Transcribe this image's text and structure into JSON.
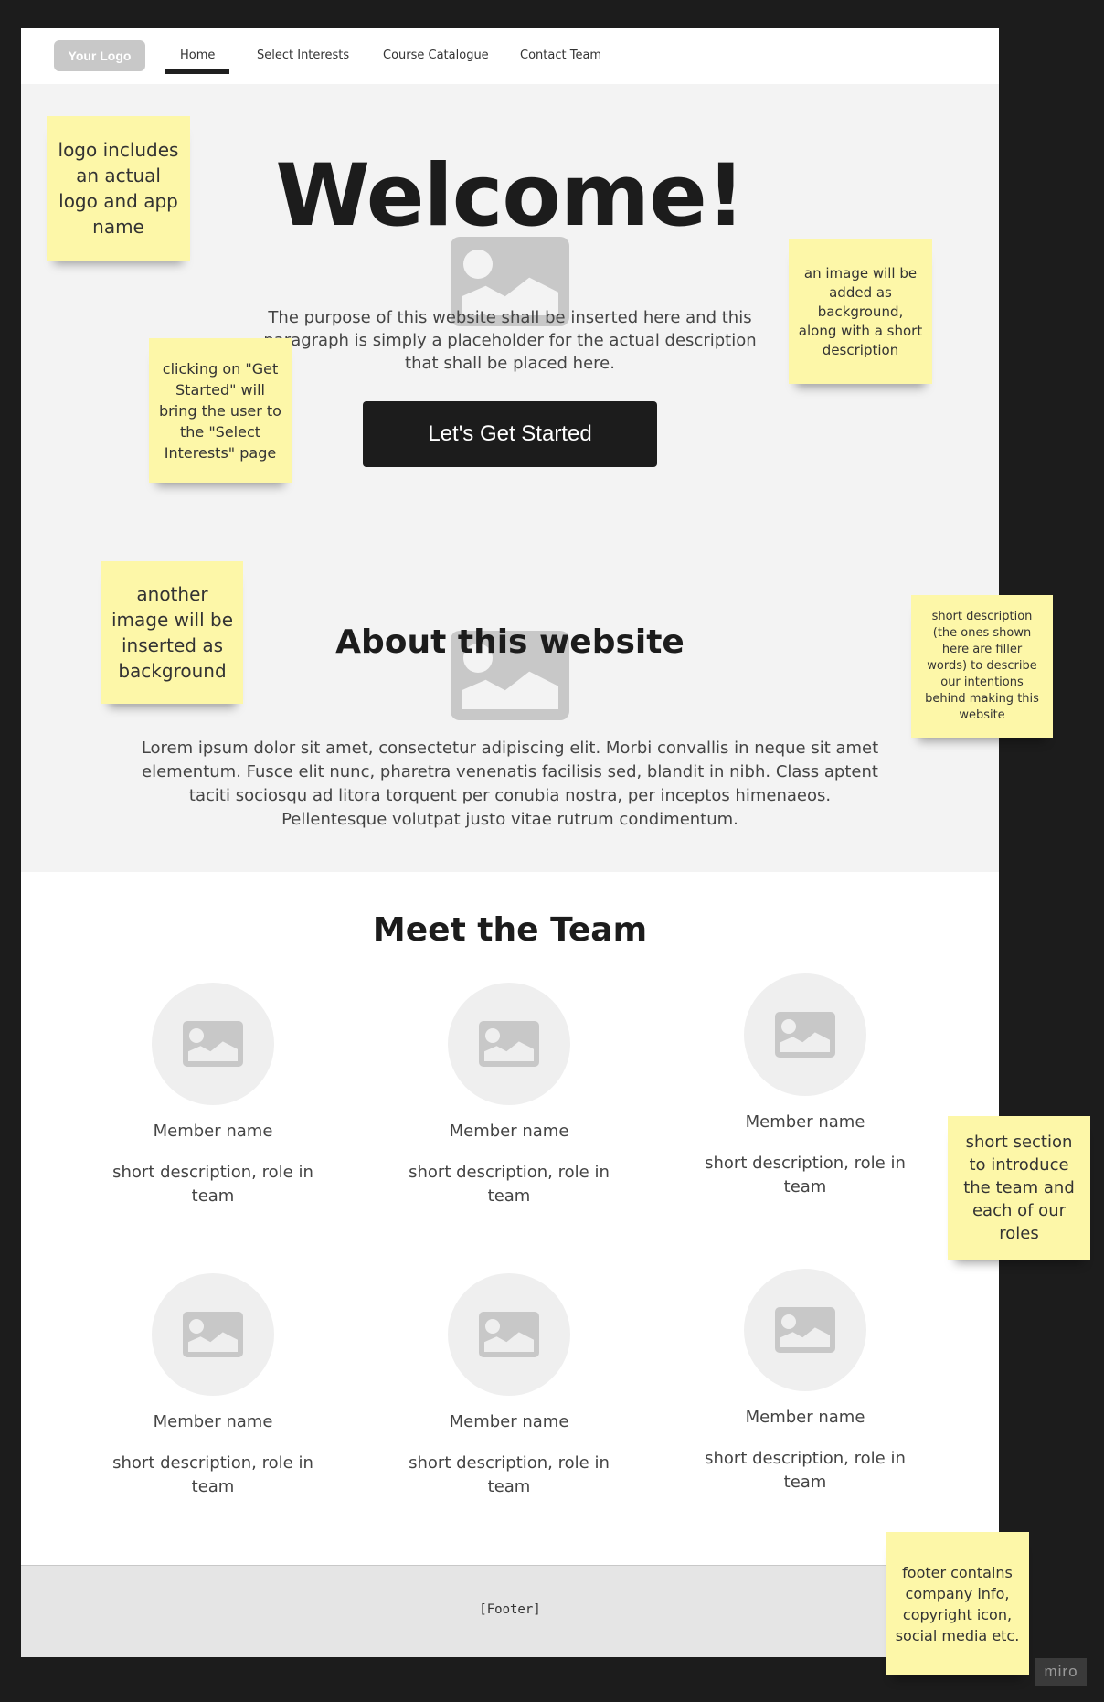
{
  "nav": {
    "logo": "Your Logo",
    "items": [
      "Home",
      "Select Interests",
      "Course Catalogue",
      "Contact Team"
    ],
    "active_index": 0
  },
  "hero": {
    "title": "Welcome!",
    "description": "The purpose of this website shall be inserted here and this paragraph is simply a placeholder for the actual description that shall be placed here.",
    "cta_label": "Let's Get Started"
  },
  "about": {
    "title": "About this website",
    "description": "Lorem ipsum dolor sit amet, consectetur adipiscing elit. Morbi convallis in neque sit amet elementum. Fusce elit nunc, pharetra venenatis facilisis sed, blandit in nibh. Class aptent taciti sociosqu ad litora torquent per conubia nostra, per inceptos himenaeos. Pellentesque volutpat justo vitae rutrum condimentum."
  },
  "team": {
    "title": "Meet the Team",
    "members": [
      {
        "name": "Member name",
        "role": "short description, role in team"
      },
      {
        "name": "Member name",
        "role": "short description, role in team"
      },
      {
        "name": "Member name",
        "role": "short description, role in team"
      },
      {
        "name": "Member name",
        "role": "short description, role in team"
      },
      {
        "name": "Member name",
        "role": "short description, role in team"
      },
      {
        "name": "Member name",
        "role": "short description, role in team"
      }
    ]
  },
  "footer": {
    "text": "[Footer]"
  },
  "sticky_notes": [
    "logo includes an actual logo and app name",
    "an image will be added as background, along with a short description",
    "clicking on \"Get Started\" will bring the user to the \"Select Interests\" page",
    "another image will be inserted as background",
    "short description (the ones shown here are filler words) to describe our intentions behind making this website",
    "short section to introduce the team and each of our roles",
    "footer contains company info, copyright icon, social media etc."
  ],
  "watermark": "miro",
  "colors": {
    "canvas": "#1c1c1c",
    "hero_bg": "#f3f3f3",
    "button": "#1c1c1c",
    "sticky": "#fdf7a8",
    "footer_bg": "#e5e5e5"
  },
  "icons": {
    "placeholder": "image-placeholder-icon"
  }
}
